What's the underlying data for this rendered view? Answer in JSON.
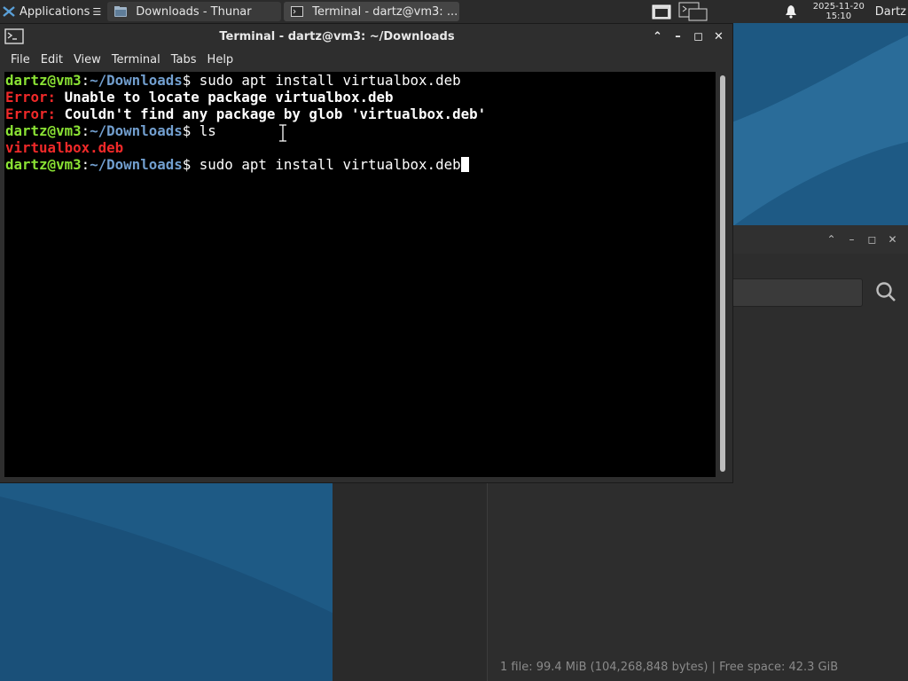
{
  "panel": {
    "apps_label": "Applications",
    "tasks": [
      {
        "label": "Downloads - Thunar",
        "icon": "folder-icon"
      },
      {
        "label": "Terminal - dartz@vm3: ...",
        "icon": "terminal-icon"
      }
    ],
    "clock_date": "2025-11-20",
    "clock_time": "15:10",
    "user": "Dartz"
  },
  "terminal": {
    "title": "Terminal - dartz@vm3: ~/Downloads",
    "menu": [
      "File",
      "Edit",
      "View",
      "Terminal",
      "Tabs",
      "Help"
    ],
    "prompt": {
      "user_host": "dartz@vm3",
      "sep": ":",
      "path": "~/Downloads",
      "dollar": "$"
    },
    "lines": [
      {
        "type": "prompt",
        "cmd": " sudo apt install virtualbox.deb"
      },
      {
        "type": "error",
        "label": "Error:",
        "msg": " Unable to locate package virtualbox.deb"
      },
      {
        "type": "error",
        "label": "Error:",
        "msg": " Couldn't find any package by glob 'virtualbox.deb'"
      },
      {
        "type": "prompt",
        "cmd": " ls"
      },
      {
        "type": "file",
        "text": "virtualbox.deb"
      },
      {
        "type": "prompt",
        "cmd": " sudo apt install virtualbox.deb",
        "cursor": true
      }
    ]
  },
  "thunar": {
    "status": "1 file: 99.4 MiB (104,268,848 bytes)  |  Free space: 42.3 GiB"
  },
  "colors": {
    "prompt_user": "#8ae234",
    "prompt_path": "#729fcf",
    "error": "#ef2929",
    "wallpaper": "#1f5c87"
  }
}
